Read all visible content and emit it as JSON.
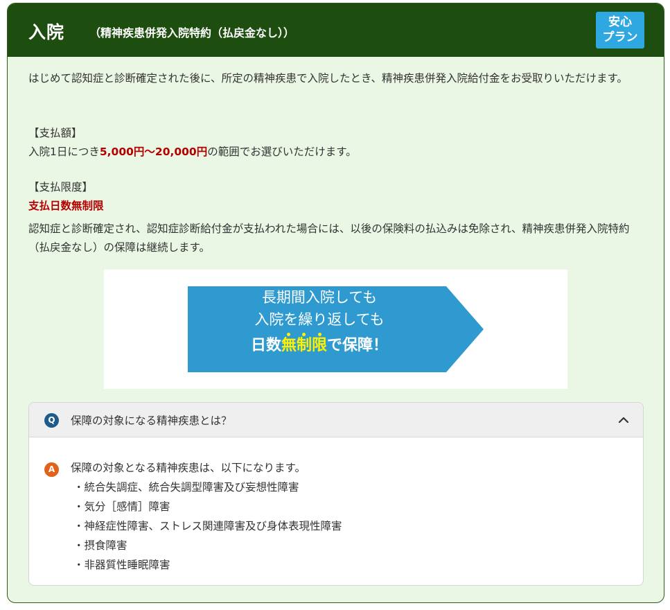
{
  "header": {
    "title": "入院",
    "subtitle": "（精神疾患併発入院特約（払戻金なし））",
    "badge_line1": "安心",
    "badge_line2": "プラン"
  },
  "intro": "はじめて認知症と診断確定された後に、所定の精神疾患で入院したとき、精神疾患併発入院給付金をお受取りいただけます。",
  "payment": {
    "heading": "【支払額】",
    "prefix": "入院1日につき",
    "amount": "5,000円～20,000円",
    "suffix": "の範囲でお選びいただけます。"
  },
  "limit": {
    "heading": "【支払限度】",
    "value": "支払日数無制限"
  },
  "continuation": "認知症と診断確定され、認知症診断給付金が支払われた場合には、以後の保険料の払込みは免除され、精神疾患併発入院特約（払戻金なし）の保障は継続します。",
  "banner": {
    "line1": "長期間入院しても",
    "line2": "入院を繰り返しても",
    "strong_pre": "日数",
    "strong_c1": "無",
    "strong_c2": "制",
    "strong_c3": "限",
    "strong_post": "で保障！",
    "color": "#2e9ad0",
    "highlight_color": "#fff200"
  },
  "faq": {
    "q_icon": "Q",
    "question": "保障の対象になる精神疾患とは？",
    "a_icon": "A",
    "answer_lead": "保障の対象となる精神疾患は、以下になります。",
    "items": [
      "・統合失調症、統合失調型障害及び妄想性障害",
      "・気分［感情］障害",
      "・神経症性障害、ストレス関連障害及び身体表現性障害",
      "・摂食障害",
      "・非器質性睡眠障害"
    ],
    "toggle_icon": "chevron-up-icon"
  },
  "colors": {
    "header_bg": "#1d4d0f",
    "card_bg": "#eaf7e4",
    "badge_bg": "#2fa7e0",
    "emphasis_red": "#b30000"
  }
}
